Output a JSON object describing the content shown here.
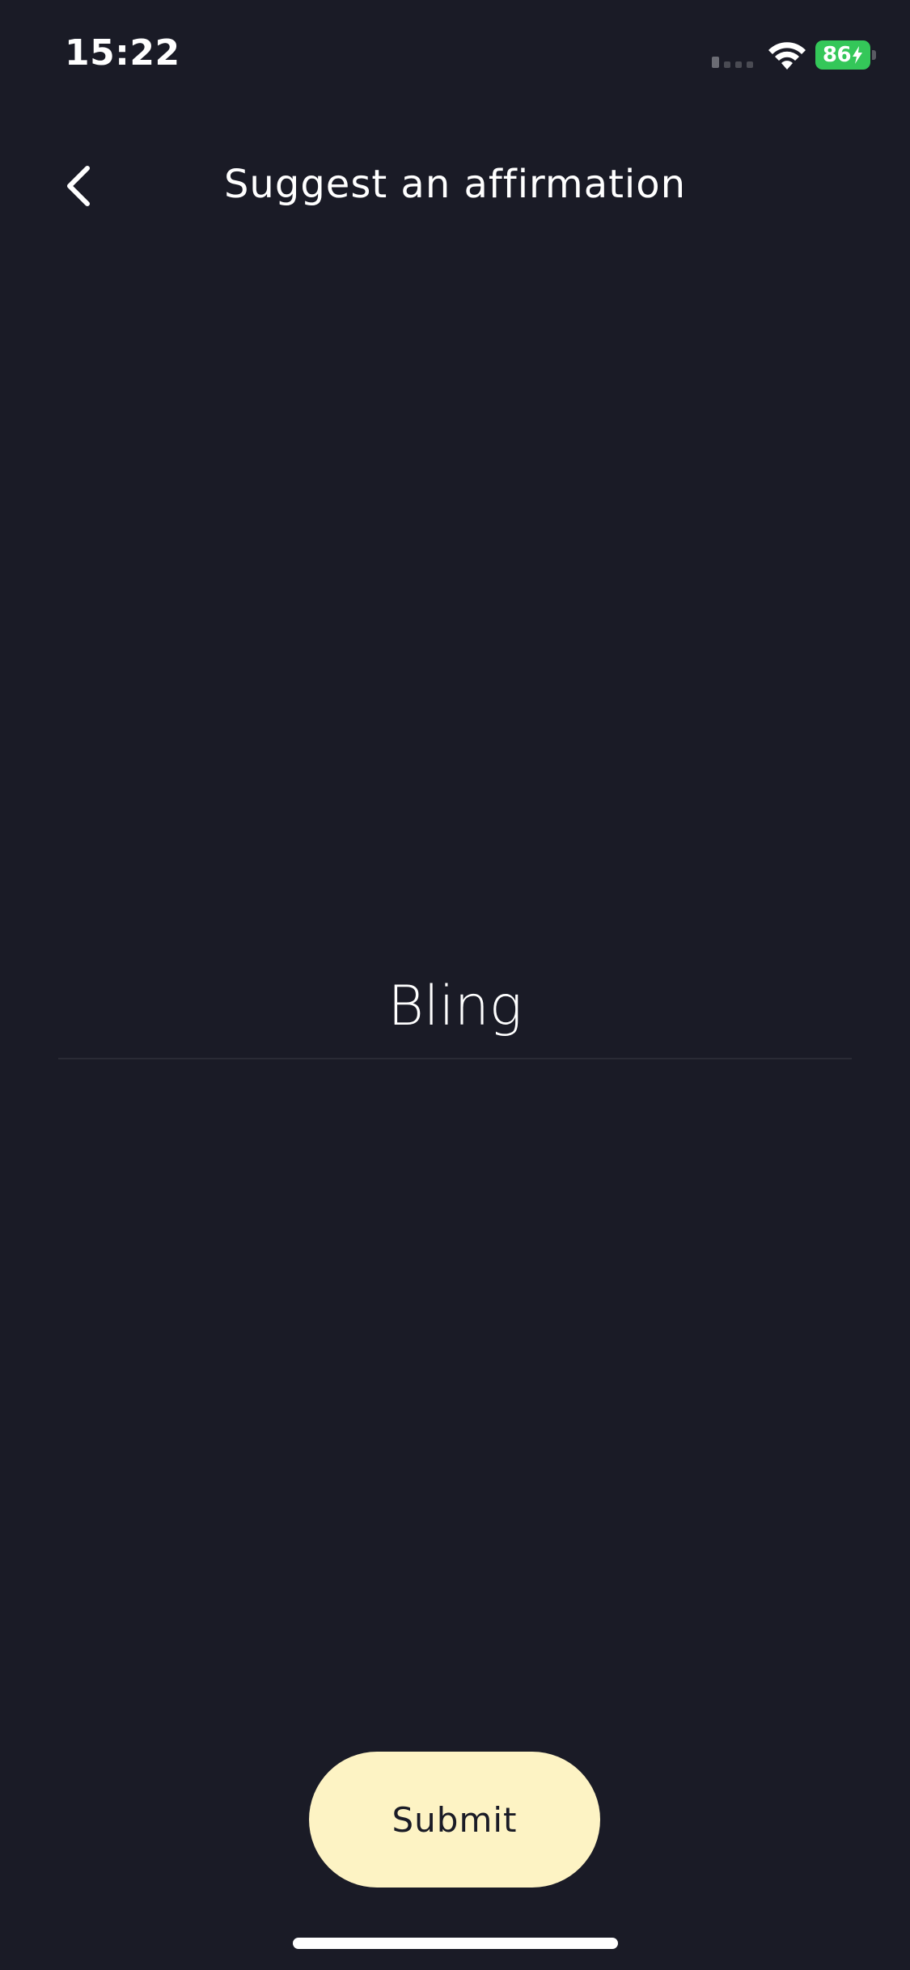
{
  "status_bar": {
    "time": "15:22",
    "battery_level": "86",
    "battery_color": "#34c759",
    "icons": [
      "cellular-signal-icon",
      "wifi-icon",
      "battery-charging-icon"
    ]
  },
  "header": {
    "title": "Suggest an affirmation",
    "back_icon": "chevron-left-icon"
  },
  "form": {
    "affirmation_value": "Bling"
  },
  "actions": {
    "submit_label": "Submit"
  },
  "colors": {
    "background": "#1a1b26",
    "submit_background": "#fdf3c4",
    "text_primary": "#ffffff"
  }
}
